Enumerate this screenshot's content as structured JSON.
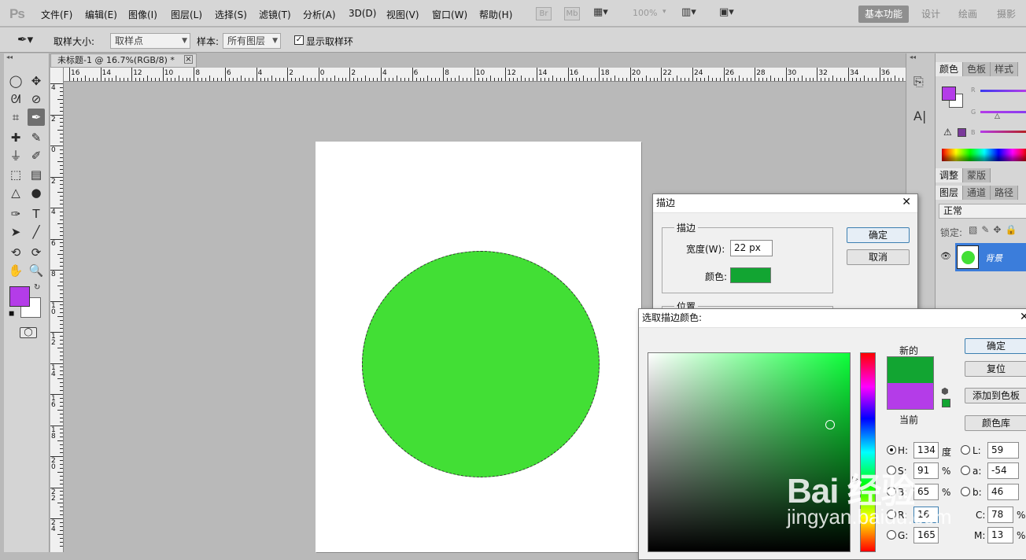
{
  "app": {
    "logo": "Ps",
    "menu": [
      "文件(F)",
      "编辑(E)",
      "图像(I)",
      "图层(L)",
      "选择(S)",
      "滤镜(T)",
      "分析(A)",
      "3D(D)",
      "视图(V)",
      "窗口(W)",
      "帮助(H)"
    ],
    "bridge_label": "Br",
    "minibridge_label": "Mb",
    "zoom": "100%",
    "workspaces": [
      "基本功能",
      "设计",
      "绘画",
      "摄影"
    ]
  },
  "options_bar": {
    "sample_size_label": "取样大小:",
    "sample_size_value": "取样点",
    "sample_label": "样本:",
    "sample_value": "所有图层",
    "show_ring_label": "显示取样环",
    "show_ring_checked": true
  },
  "toolbox": {
    "foreground_color": "#b43ce8",
    "background_color": "#ffffff"
  },
  "document": {
    "tab_title": "未标题-1 @ 16.7%(RGB/8) *",
    "ruler_h": [
      "16",
      "14",
      "12",
      "10",
      "8",
      "6",
      "4",
      "2",
      "0",
      "2",
      "4",
      "6",
      "8",
      "10",
      "12",
      "14",
      "16",
      "18",
      "20",
      "22",
      "24",
      "26",
      "28",
      "30",
      "32",
      "34",
      "36"
    ],
    "ruler_v": [
      "4",
      "2",
      "0",
      "2",
      "4",
      "6",
      "8",
      "10",
      "12",
      "14",
      "16",
      "18",
      "20",
      "22",
      "24"
    ],
    "circle_color": "#42df35"
  },
  "panels": {
    "color_tabs": [
      "颜色",
      "色板",
      "样式"
    ],
    "channel_labels": [
      "R",
      "G",
      "B"
    ],
    "adjust_tabs": [
      "调整",
      "蒙版"
    ],
    "layer_tabs": [
      "图层",
      "通道",
      "路径"
    ],
    "blend_mode": "正常",
    "lock_label": "锁定:",
    "layer_name": "背景",
    "layer_thumb_color": "#42df35"
  },
  "stroke_dialog": {
    "title": "描边",
    "group_stroke": "描边",
    "width_label": "宽度(W):",
    "width_value": "22 px",
    "color_label": "颜色:",
    "color_value": "#12a532",
    "group_position": "位置",
    "ok": "确定",
    "cancel": "取消"
  },
  "color_picker": {
    "title": "选取描边颜色:",
    "new_label": "新的",
    "current_label": "当前",
    "new_color": "#12a532",
    "current_color": "#b43ce8",
    "ok": "确定",
    "reset": "复位",
    "add_swatch": "添加到色板",
    "color_libraries": "颜色库",
    "fields": {
      "H": {
        "label": "H:",
        "value": "134",
        "unit": "度"
      },
      "S": {
        "label": "S:",
        "value": "91",
        "unit": "%"
      },
      "B": {
        "label": "B:",
        "value": "65",
        "unit": "%"
      },
      "R": {
        "label": "R:",
        "value": "16"
      },
      "G": {
        "label": "G:",
        "value": "165"
      },
      "L": {
        "label": "L:",
        "value": "59"
      },
      "a": {
        "label": "a:",
        "value": "-54"
      },
      "b": {
        "label": "b:",
        "value": "46"
      },
      "C": {
        "label": "C:",
        "value": "78",
        "unit": "%"
      },
      "M": {
        "label": "M:",
        "value": "13",
        "unit": "%"
      }
    }
  },
  "watermark": {
    "logo": "Bai 经验",
    "url": "jingyan.baidu.com"
  }
}
